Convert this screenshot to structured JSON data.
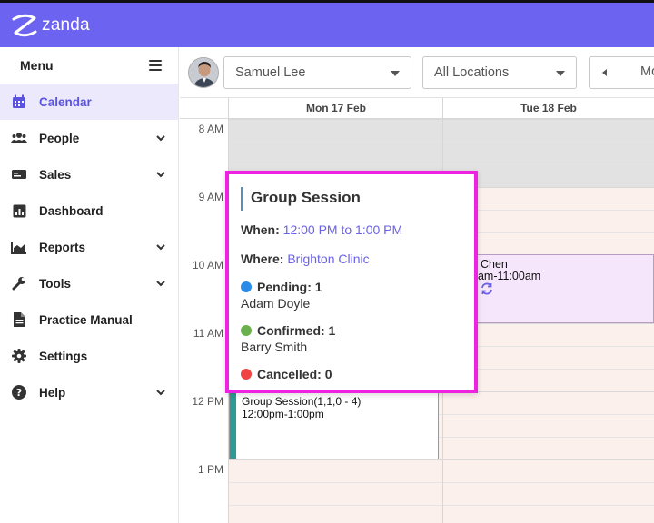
{
  "app": {
    "brand": "zanda",
    "accent_color": "#6c63f0"
  },
  "sidebar": {
    "menu_title": "Menu",
    "items": [
      {
        "label": "Calendar",
        "icon": "calendar-icon",
        "active": true,
        "expandable": false
      },
      {
        "label": "People",
        "icon": "people-icon",
        "active": false,
        "expandable": true
      },
      {
        "label": "Sales",
        "icon": "sales-icon",
        "active": false,
        "expandable": true
      },
      {
        "label": "Dashboard",
        "icon": "dashboard-icon",
        "active": false,
        "expandable": false
      },
      {
        "label": "Reports",
        "icon": "reports-icon",
        "active": false,
        "expandable": true
      },
      {
        "label": "Tools",
        "icon": "wrench-icon",
        "active": false,
        "expandable": true
      },
      {
        "label": "Practice Manual",
        "icon": "document-icon",
        "active": false,
        "expandable": false
      },
      {
        "label": "Settings",
        "icon": "gear-icon",
        "active": false,
        "expandable": false
      },
      {
        "label": "Help",
        "icon": "help-icon",
        "active": false,
        "expandable": true
      }
    ]
  },
  "toolbar": {
    "practitioner": "Samuel Lee",
    "location": "All Locations",
    "view_partial": "Mo"
  },
  "calendar": {
    "days": [
      "Mon 17 Feb",
      "Tue 18 Feb"
    ],
    "times": [
      "8 AM",
      "9 AM",
      "10 AM",
      "11 AM",
      "12 PM",
      "1 PM"
    ],
    "events": [
      {
        "title": "Group Session(1,1,0 - 4)",
        "time": "12:00pm-1:00pm",
        "color": "#2d9a96"
      },
      {
        "title": "Chen",
        "time": "0am-11:00am",
        "color": "#f6e6fb"
      }
    ]
  },
  "popup": {
    "title": "Group Session",
    "when_label": "When:",
    "when_value": "12:00 PM to 1:00 PM",
    "where_label": "Where:",
    "where_value": "Brighton Clinic",
    "pending_label": "Pending: 1",
    "pending_person": "Adam Doyle",
    "confirmed_label": "Confirmed: 1",
    "confirmed_person": "Barry Smith",
    "cancelled_label": "Cancelled: 0",
    "colors": {
      "pending": "#2b8be8",
      "confirmed": "#6ab04c",
      "cancelled": "#f04444",
      "highlight_border": "#ee22e0"
    }
  }
}
